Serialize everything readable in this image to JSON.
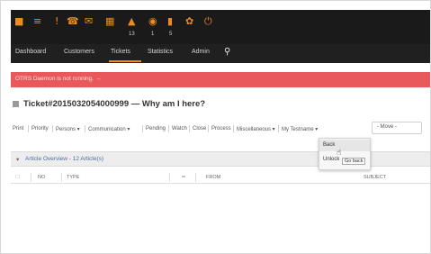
{
  "toolbar": {
    "icons": [
      {
        "name": "folder-icon",
        "glyph": "■"
      },
      {
        "name": "list-icon",
        "glyph": "≡"
      },
      {
        "name": "alert-icon",
        "glyph": "!"
      },
      {
        "name": "phone-icon",
        "glyph": "☎"
      },
      {
        "name": "mail-icon",
        "glyph": "✉"
      },
      {
        "name": "grid-icon",
        "glyph": "▦"
      },
      {
        "name": "lock-icon",
        "glyph": "▲",
        "badge": "13"
      },
      {
        "name": "eye-icon",
        "glyph": "◉",
        "badge": "1"
      },
      {
        "name": "notepad-icon",
        "glyph": "▮",
        "badge": "5"
      },
      {
        "name": "gear-icon",
        "glyph": "✿"
      },
      {
        "name": "power-icon",
        "glyph": "⏻"
      }
    ]
  },
  "nav": {
    "items": [
      "Dashboard",
      "Customers",
      "Tickets",
      "Statistics",
      "Admin"
    ],
    "active": "Tickets"
  },
  "alert": {
    "text": "OTRS Daemon is not running. →"
  },
  "ticket": {
    "title": "Ticket#2015032054000999 — Why am I here?"
  },
  "actions": {
    "items": [
      "Print",
      "Priority",
      "Persons ▾",
      "Communication ▾",
      "Pending",
      "Watch",
      "Close",
      "Process",
      "Miscellaneous ▾",
      "My Testname ▾"
    ],
    "move_select": "- Move -"
  },
  "dropdown": {
    "items": [
      "Back",
      "Unlock"
    ],
    "tooltip": "Go back"
  },
  "article_overview": {
    "title": "Article Overview - 12 Article(s)",
    "columns": [
      "NO",
      "TYPE",
      "FROM",
      "SUBJECT"
    ]
  },
  "colors": {
    "toolbar_bg": "#1a1a1a",
    "icon_orange": "#f08a1a",
    "alert_red": "#e9595b"
  }
}
